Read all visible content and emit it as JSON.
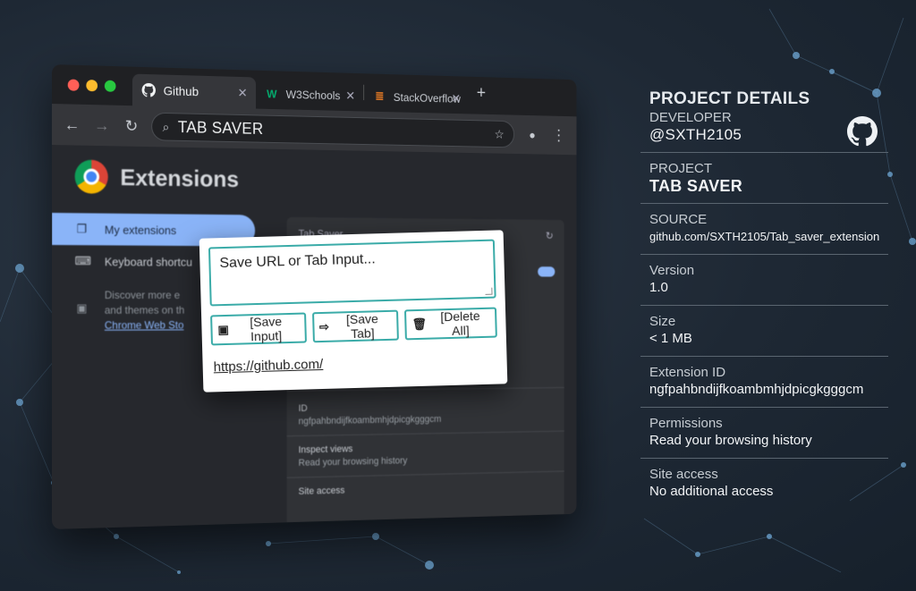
{
  "browser": {
    "tabs": [
      {
        "label": "Github",
        "icon": "github-icon",
        "active": true
      },
      {
        "label": "W3Schools",
        "icon": "w3schools-icon",
        "active": false
      },
      {
        "label": "StackOverflow",
        "icon": "stackoverflow-icon",
        "active": false
      }
    ],
    "address": "TAB SAVER"
  },
  "extensions_page": {
    "title": "Extensions",
    "sidebar": {
      "my_extensions": "My extensions",
      "keyboard_shortcuts": "Keyboard shortcu",
      "discover_line1": "Discover more e",
      "discover_line2": "and themes on th",
      "store_link": "Chrome Web Sto"
    },
    "card": {
      "name": "Tab Saver",
      "id_label": "ID",
      "id_value": "ngfpahbndijfkoambmhjdpicgkgggcm",
      "inspect_label": "Inspect views",
      "inspect_value": "Read your browsing history",
      "site_access": "Site access"
    }
  },
  "popup": {
    "input_placeholder": "Save URL or Tab Input...",
    "save_input_label": "[Save Input]",
    "save_tab_label": "[Save Tab]",
    "delete_all_label": "[Delete All]",
    "saved_link": "https://github.com/"
  },
  "panel": {
    "title": "PROJECT DETAILS",
    "developer_label": "DEVELOPER",
    "developer_value": "@SXTH2105",
    "project_label": "PROJECT",
    "project_value": "TAB SAVER",
    "source_label": "SOURCE",
    "source_value": "github.com/SXTH2105/Tab_saver_extension",
    "version_label": "Version",
    "version_value": "1.0",
    "size_label": "Size",
    "size_value": "< 1 MB",
    "ext_id_label": "Extension ID",
    "ext_id_value": "ngfpahbndijfkoambmhjdpicgkgggcm",
    "permissions_label": "Permissions",
    "permissions_value": "Read your browsing history",
    "site_access_label": "Site access",
    "site_access_value": "No additional access"
  },
  "colors": {
    "accent_teal": "#3aaba8",
    "chrome_blue": "#8ab4f8",
    "background": "#1e2834"
  }
}
